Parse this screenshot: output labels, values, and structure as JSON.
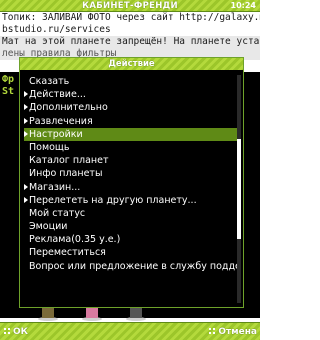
{
  "header": {
    "title": "КАБИНЕТ-ФРЕНДИ",
    "clock": "10:24"
  },
  "chat": {
    "lines": [
      "Топик: ЗАЛИВАЙ ФОТО через сайт http://galaxy.mo",
      "bstudio.ru/services",
      "Мат на этой планете запрещён! На планете установ",
      "лены правила фильтры"
    ],
    "labels": [
      "Фр",
      "St"
    ]
  },
  "dialog": {
    "title": "Действие",
    "items": [
      {
        "label": "Сказать",
        "submenu": false,
        "selected": false
      },
      {
        "label": "Действие...",
        "submenu": true,
        "selected": false
      },
      {
        "label": "Дополнительно",
        "submenu": true,
        "selected": false
      },
      {
        "label": "Развлечения",
        "submenu": true,
        "selected": false
      },
      {
        "label": "Настройки",
        "submenu": true,
        "selected": true
      },
      {
        "label": "Помощь",
        "submenu": false,
        "selected": false
      },
      {
        "label": "Каталог планет",
        "submenu": false,
        "selected": false
      },
      {
        "label": "Инфо планеты",
        "submenu": false,
        "selected": false
      },
      {
        "label": "Магазин...",
        "submenu": true,
        "selected": false
      },
      {
        "label": "Перелететь на другую планету...",
        "submenu": true,
        "selected": false
      },
      {
        "label": "Мой статус",
        "submenu": false,
        "selected": false
      },
      {
        "label": "Эмоции",
        "submenu": false,
        "selected": false
      },
      {
        "label": "Реклама(0.35 у.е.)",
        "submenu": false,
        "selected": false
      },
      {
        "label": "Переместиться",
        "submenu": false,
        "selected": false
      },
      {
        "label": "Вопрос или предложение в службу подде",
        "submenu": false,
        "selected": false
      }
    ],
    "scroll_fraction": 0.5
  },
  "softkeys": {
    "left": "ОК",
    "right": "Отмена"
  },
  "colors": {
    "accent": "#9cc62a",
    "selected": "#5f8a16",
    "dialog_bg": "#000000"
  }
}
